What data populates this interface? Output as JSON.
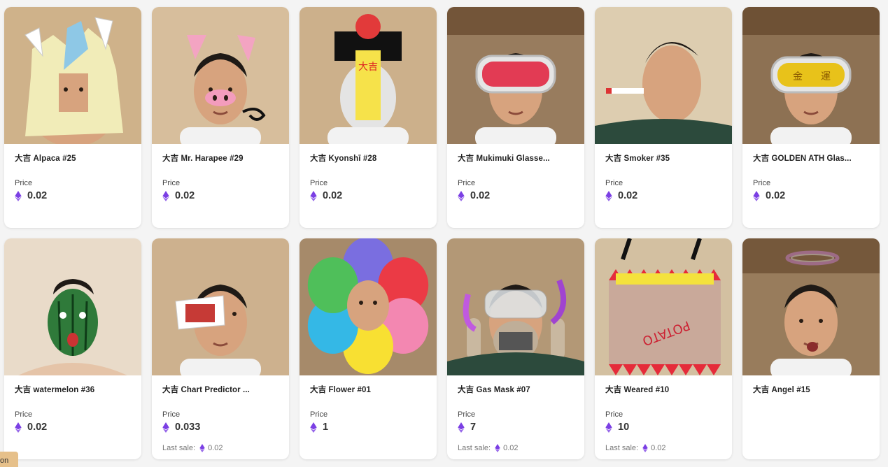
{
  "items": [
    {
      "name": "大吉 Alpaca #25",
      "price_label": "Price",
      "price": "0.02",
      "last_sale_label": "",
      "last_sale": "",
      "bg": "#c9a87a",
      "mask": "alpaca"
    },
    {
      "name": "大吉 Mr. Harapee #29",
      "price_label": "Price",
      "price": "0.02",
      "last_sale_label": "",
      "last_sale": "",
      "bg": "#d2b58f",
      "mask": "pig"
    },
    {
      "name": "大吉 Kyonshī #28",
      "price_label": "Price",
      "price": "0.02",
      "last_sale_label": "",
      "last_sale": "",
      "bg": "#c5a57c",
      "mask": "kyonshi"
    },
    {
      "name": "大吉 Mukimuki Glasse...",
      "price_label": "Price",
      "price": "0.02",
      "last_sale_label": "",
      "last_sale": "",
      "bg": "#8a6a48",
      "mask": "glasses-red"
    },
    {
      "name": "大吉 Smoker #35",
      "price_label": "Price",
      "price": "0.02",
      "last_sale_label": "",
      "last_sale": "",
      "bg": "#d9c6a6",
      "mask": "smoker"
    },
    {
      "name": "大吉 GOLDEN ATH Glas...",
      "price_label": "Price",
      "price": "0.02",
      "last_sale_label": "",
      "last_sale": "",
      "bg": "#7e5e3c",
      "mask": "glasses-gold"
    },
    {
      "name": "大吉 watermelon #36",
      "price_label": "Price",
      "price": "0.02",
      "last_sale_label": "",
      "last_sale": "",
      "bg": "#e6d6c2",
      "mask": "watermelon"
    },
    {
      "name": "大吉 Chart Predictor ...",
      "price_label": "Price",
      "price": "0.033",
      "last_sale_label": "Last sale:",
      "last_sale": "0.02",
      "bg": "#c7a77f",
      "mask": "predictor"
    },
    {
      "name": "大吉 Flower #01",
      "price_label": "Price",
      "price": "1",
      "last_sale_label": "",
      "last_sale": "",
      "bg": "#9a7a56",
      "mask": "flower"
    },
    {
      "name": "大吉 Gas Mask #07",
      "price_label": "Price",
      "price": "7",
      "last_sale_label": "Last sale:",
      "last_sale": "0.02",
      "bg": "#a98a64",
      "mask": "gasmask"
    },
    {
      "name": "大吉 Weared #10",
      "price_label": "Price",
      "price": "10",
      "last_sale_label": "Last sale:",
      "last_sale": "0.02",
      "bg": "#cdb895",
      "mask": "chips"
    },
    {
      "name": "大吉 Angel #15",
      "price_label": "Price",
      "price": "",
      "last_sale_label": "",
      "last_sale": "",
      "bg": "#8a6a46",
      "mask": "angel"
    }
  ],
  "corner_tab": "on",
  "colors": {
    "eth": "#7b3fe4",
    "card_bg": "#ffffff",
    "page_bg": "#f4f4f4"
  }
}
